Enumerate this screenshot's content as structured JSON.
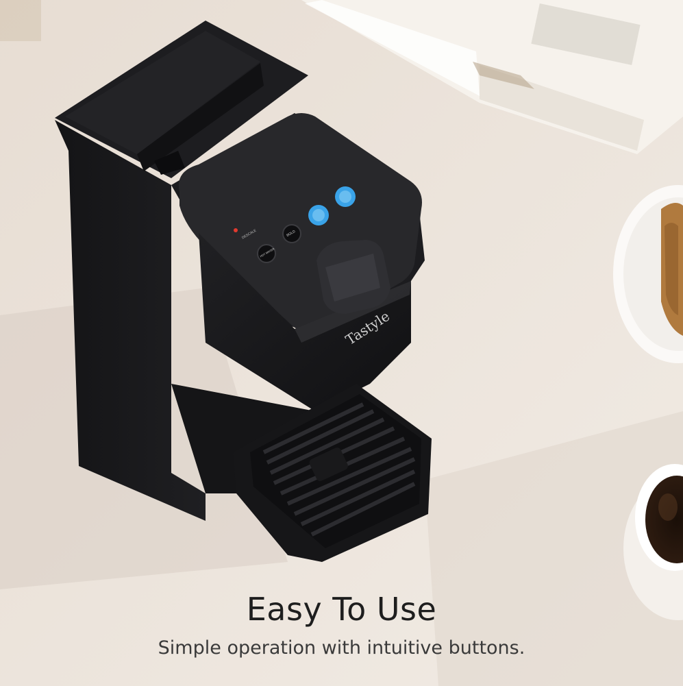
{
  "headline": "Easy To Use",
  "subline": "Simple operation with intuitive buttons.",
  "product": {
    "brand_logo": "Tastyle",
    "panel_labels": {
      "descale": "DESCALE",
      "hot_water": "HOT WATER",
      "bold": "BOLD"
    }
  },
  "colors": {
    "background": "#e9e1d9",
    "machine": "#1a1a1c",
    "accent_button": "#3aa3e8",
    "headline": "#1e1e1e",
    "subline": "#3a3a3a"
  }
}
